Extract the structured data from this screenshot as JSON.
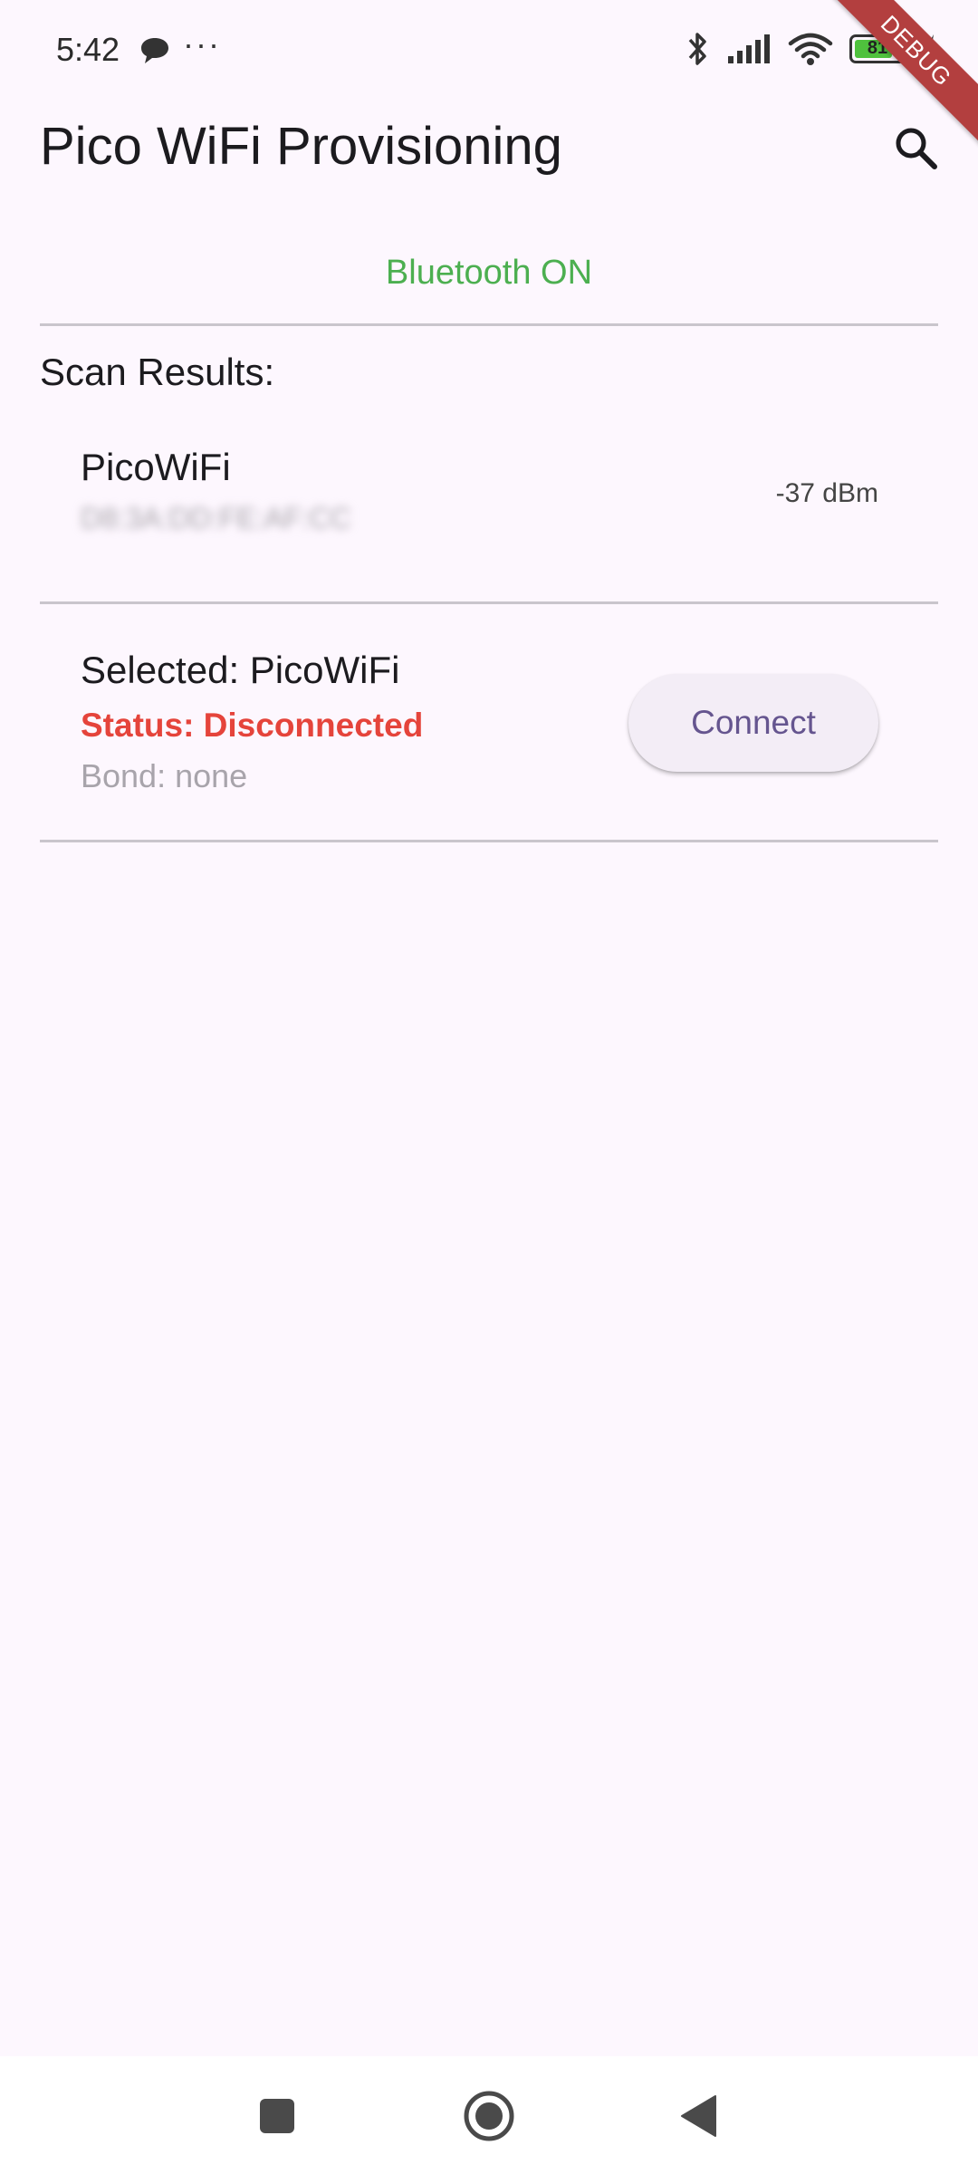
{
  "status_bar": {
    "time": "5:42",
    "dots": "···",
    "battery_level": "81",
    "battery_fraction": 0.81
  },
  "debug_ribbon": "DEBUG",
  "app_bar": {
    "title": "Pico WiFi Provisioning"
  },
  "bluetooth": {
    "status": "Bluetooth ON",
    "status_color": "#4caf50"
  },
  "scan": {
    "label": "Scan Results:",
    "devices": [
      {
        "name": "PicoWiFi",
        "mac": "D8:3A:DD:FE:AF:CC",
        "rssi": "-37 dBm"
      }
    ]
  },
  "selected": {
    "title": "Selected: PicoWiFi",
    "status": "Status: Disconnected",
    "status_color": "#e5443b",
    "bond": "Bond: none",
    "connect_label": "Connect"
  },
  "colors": {
    "background": "#fdf7fe",
    "accent": "#65558f",
    "divider": "#c9c5cc"
  }
}
